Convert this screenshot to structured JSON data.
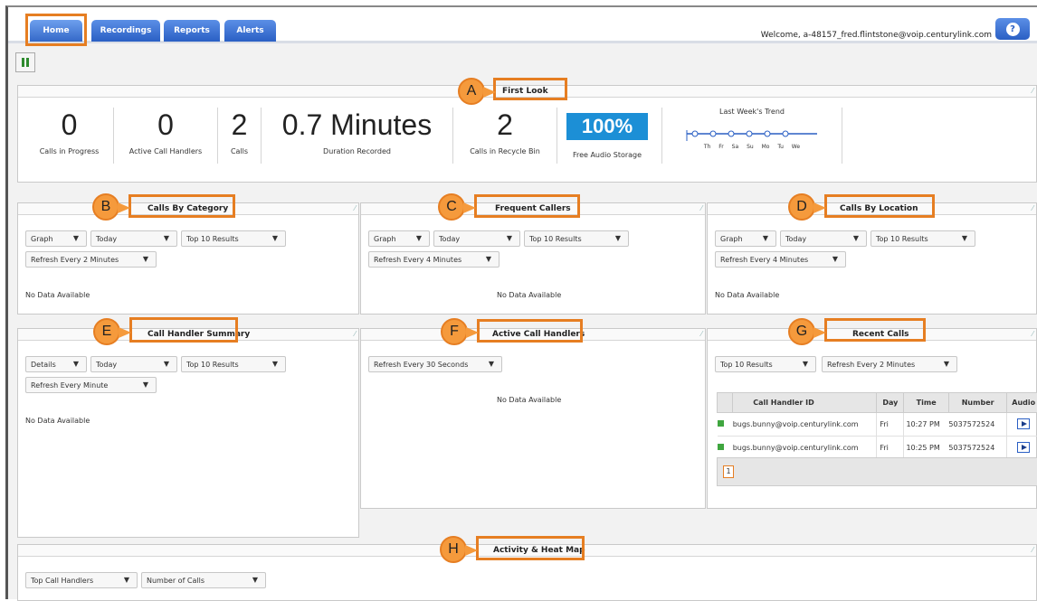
{
  "tabs": [
    {
      "label": "Home"
    },
    {
      "label": "Recordings"
    },
    {
      "label": "Reports"
    },
    {
      "label": "Alerts"
    }
  ],
  "welcome": "Welcome, a-48157_fred.flintstone@voip.centurylink.com",
  "help_icon": "help-icon",
  "first_look": {
    "title": "First Look",
    "callout": "A",
    "stats": [
      {
        "value": "0",
        "label": "Calls in Progress"
      },
      {
        "value": "0",
        "label": "Active Call Handlers"
      },
      {
        "value": "2",
        "label": "Calls"
      },
      {
        "value": "0.7 Minutes",
        "label": "Duration Recorded"
      },
      {
        "value": "2",
        "label": "Calls in Recycle Bin"
      }
    ],
    "storage": {
      "value": "100%",
      "label": "Free Audio Storage"
    },
    "trend": {
      "title": "Last Week's Trend",
      "days": [
        "Th",
        "Fr",
        "Sa",
        "Su",
        "Mo",
        "Tu",
        "We"
      ]
    }
  },
  "calls_by_category": {
    "title": "Calls By Category",
    "callout": "B",
    "view": "Graph",
    "period": "Today",
    "results": "Top 10 Results",
    "refresh": "Refresh Every 2 Minutes",
    "nodata": "No Data Available"
  },
  "frequent_callers": {
    "title": "Frequent Callers",
    "callout": "C",
    "view": "Graph",
    "period": "Today",
    "results": "Top 10 Results",
    "refresh": "Refresh Every 4 Minutes",
    "nodata": "No Data Available"
  },
  "calls_by_location": {
    "title": "Calls By Location",
    "callout": "D",
    "view": "Graph",
    "period": "Today",
    "results": "Top 10 Results",
    "refresh": "Refresh Every 4 Minutes",
    "nodata": "No Data Available"
  },
  "call_handler_summary": {
    "title": "Call Handler Summary",
    "callout": "E",
    "view": "Details",
    "period": "Today",
    "results": "Top 10 Results",
    "refresh": "Refresh Every Minute",
    "nodata": "No Data Available"
  },
  "active_call_handlers": {
    "title": "Active Call Handlers",
    "callout": "F",
    "refresh": "Refresh Every 30 Seconds",
    "nodata": "No Data Available"
  },
  "recent_calls": {
    "title": "Recent Calls",
    "callout": "G",
    "results": "Top 10 Results",
    "refresh": "Refresh Every 2 Minutes",
    "columns": [
      "Call Handler ID",
      "Day",
      "Time",
      "Number",
      "Audio"
    ],
    "rows": [
      {
        "id": "bugs.bunny@voip.centurylink.com",
        "day": "Fri",
        "time": "10:27 PM",
        "number": "5037572524"
      },
      {
        "id": "bugs.bunny@voip.centurylink.com",
        "day": "Fri",
        "time": "10:25 PM",
        "number": "5037572524"
      }
    ],
    "page": "1"
  },
  "activity": {
    "title": "Activity & Heat Map",
    "callout": "H",
    "filter1": "Top Call Handlers",
    "filter2": "Number of Calls"
  },
  "colors": {
    "accent": "#e67e22",
    "tab_blue": "#2a5fc4",
    "storage_blue": "#1c8fd6"
  }
}
